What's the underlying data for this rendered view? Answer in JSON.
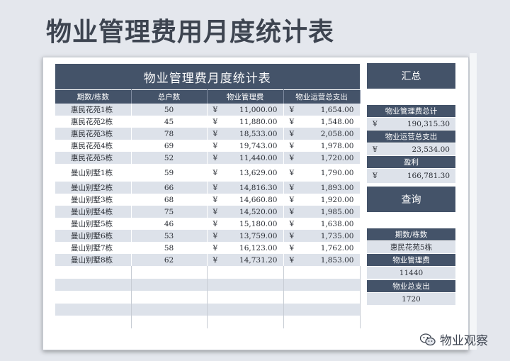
{
  "page_title": "物业管理费用月度统计表",
  "table": {
    "title": "物业管理费月度统计表",
    "headers": [
      "期数/栋数",
      "总户数",
      "物业管理费",
      "物业运营总支出"
    ],
    "currency": "¥",
    "rows": [
      {
        "name": "惠民花苑1栋",
        "households": "50",
        "fee": "11,000.00",
        "expense": "1,654.00"
      },
      {
        "name": "惠民花苑2栋",
        "households": "45",
        "fee": "11,880.00",
        "expense": "1,548.00"
      },
      {
        "name": "惠民花苑3栋",
        "households": "78",
        "fee": "18,533.00",
        "expense": "2,058.00"
      },
      {
        "name": "惠民花苑4栋",
        "households": "69",
        "fee": "19,743.00",
        "expense": "1,978.00"
      },
      {
        "name": "惠民花苑5栋",
        "households": "52",
        "fee": "11,440.00",
        "expense": "1,720.00"
      },
      {
        "name": "曼山别墅1栋",
        "households": "59",
        "fee": "13,629.00",
        "expense": "1,790.00"
      },
      {
        "name": "曼山别墅2栋",
        "households": "66",
        "fee": "14,816.30",
        "expense": "1,893.00"
      },
      {
        "name": "曼山别墅3栋",
        "households": "68",
        "fee": "14,660.80",
        "expense": "1,920.00"
      },
      {
        "name": "曼山别墅4栋",
        "households": "75",
        "fee": "14,520.00",
        "expense": "1,985.00"
      },
      {
        "name": "曼山别墅5栋",
        "households": "46",
        "fee": "15,180.00",
        "expense": "1,638.00"
      },
      {
        "name": "曼山别墅6栋",
        "households": "53",
        "fee": "13,759.00",
        "expense": "1,735.00"
      },
      {
        "name": "曼山别墅7栋",
        "households": "58",
        "fee": "16,123.00",
        "expense": "1,762.00"
      },
      {
        "name": "曼山别墅8栋",
        "households": "62",
        "fee": "14,731.20",
        "expense": "1,853.00"
      }
    ]
  },
  "summary": {
    "header": "汇总",
    "fee_total_label": "物业管理费总计",
    "fee_total_value": "190,315.30",
    "expense_total_label": "物业运营总支出",
    "expense_total_value": "23,534.00",
    "profit_label": "盈利",
    "profit_value": "166,781.30",
    "currency": "¥"
  },
  "query": {
    "header": "查询",
    "period_label": "期数/栋数",
    "period_value": "惠民花苑5栋",
    "fee_label": "物业管理费",
    "fee_value": "11440",
    "expense_label": "物业总支出",
    "expense_value": "1720"
  },
  "watermark": "物业观察",
  "colors": {
    "header_bg": "#445369",
    "stripe": "#dde2ea",
    "page_bg": "#e4e7ed"
  }
}
